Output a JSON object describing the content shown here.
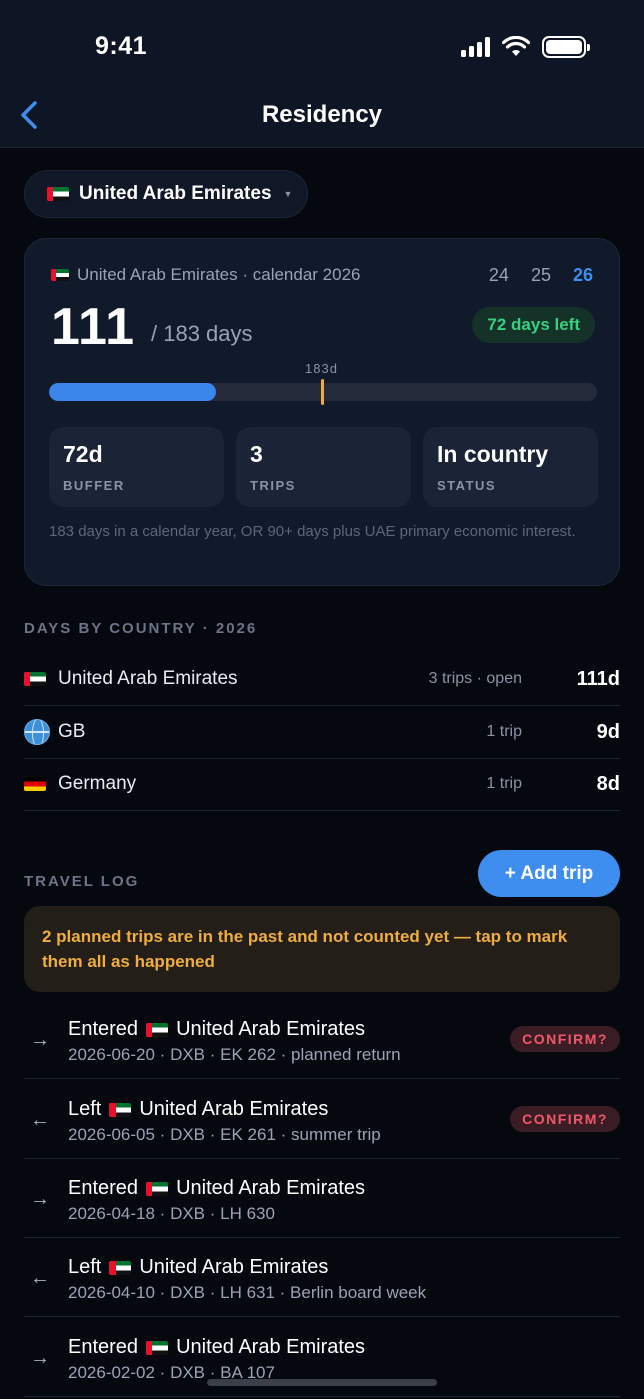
{
  "status_bar": {
    "time": "9:41"
  },
  "nav": {
    "title": "Residency"
  },
  "selector": {
    "country": "United Arab Emirates"
  },
  "card": {
    "heading": "United Arab Emirates · calendar 2026",
    "years": [
      "24",
      "25",
      "26"
    ],
    "active_year": "26",
    "days_count": "111",
    "days_of": "/ 183 days",
    "days_left": "72 days left",
    "threshold_label": "183d",
    "progress": {
      "value": 111,
      "max": 183,
      "scale_max": 365
    },
    "stats": [
      {
        "value": "72d",
        "label": "BUFFER"
      },
      {
        "value": "3",
        "label": "TRIPS"
      },
      {
        "value": "In country",
        "label": "STATUS"
      }
    ],
    "note": "183 days in a calendar year, OR 90+ days plus UAE primary economic interest."
  },
  "days_by_country": {
    "title": "DAYS BY COUNTRY · 2026",
    "rows": [
      {
        "icon": "uae-flag-icon",
        "name": "United Arab Emirates",
        "meta": "3 trips · open",
        "days": "111d"
      },
      {
        "icon": "globe-icon",
        "name": "GB",
        "meta": "1 trip",
        "days": "9d"
      },
      {
        "icon": "germany-flag-icon",
        "name": "Germany",
        "meta": "1 trip",
        "days": "8d"
      }
    ]
  },
  "travel_log": {
    "title": "TRAVEL LOG",
    "add_label": "+ Add trip",
    "warning": "2 planned trips are in the past and not counted yet — tap to mark them all as happened",
    "confirm_label": "CONFIRM?",
    "entries": [
      {
        "arrow": "→",
        "action": "Entered",
        "country": "United Arab Emirates",
        "detail": "2026-06-20 · DXB · EK 262 · planned return",
        "confirm": true
      },
      {
        "arrow": "←",
        "action": "Left",
        "country": "United Arab Emirates",
        "detail": "2026-06-05 · DXB · EK 261 · summer trip",
        "confirm": true
      },
      {
        "arrow": "→",
        "action": "Entered",
        "country": "United Arab Emirates",
        "detail": "2026-04-18 · DXB · LH 630",
        "confirm": false
      },
      {
        "arrow": "←",
        "action": "Left",
        "country": "United Arab Emirates",
        "detail": "2026-04-10 · DXB · LH 631 · Berlin board week",
        "confirm": false
      },
      {
        "arrow": "→",
        "action": "Entered",
        "country": "United Arab Emirates",
        "detail": "2026-02-02 · DXB · BA 107",
        "confirm": false
      }
    ]
  },
  "colors": {
    "accent": "#3e8ef0",
    "success": "#36d07e",
    "warning": "#efad3e",
    "danger": "#f0596b",
    "threshold": "#f0a94a"
  }
}
